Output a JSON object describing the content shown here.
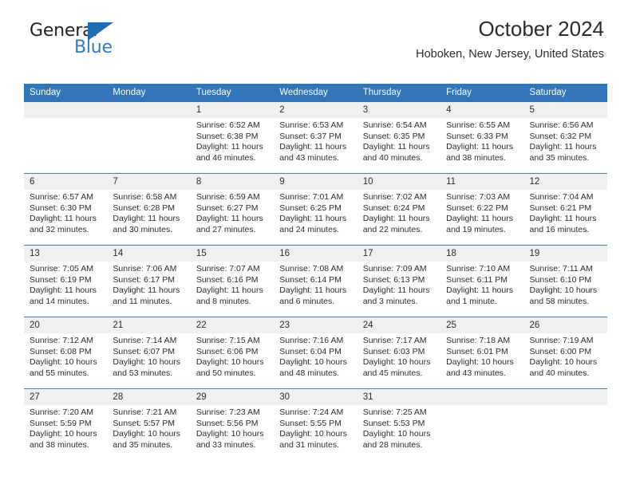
{
  "brand": {
    "name_top": "General",
    "name_bottom": "Blue",
    "logo_icon": "blue-triangle-icon",
    "accent_color": "#2e7cc4"
  },
  "header": {
    "title": "October 2024",
    "subtitle": "Hoboken, New Jersey, United States"
  },
  "theme": {
    "header_blue": "#3275b8",
    "row_band_gray": "#f0f0f0",
    "separator": "#4a7ca8"
  },
  "weekdays": [
    "Sunday",
    "Monday",
    "Tuesday",
    "Wednesday",
    "Thursday",
    "Friday",
    "Saturday"
  ],
  "weeks": [
    {
      "numbers": [
        "",
        "",
        "1",
        "2",
        "3",
        "4",
        "5"
      ],
      "cells": [
        {
          "sunrise": "",
          "sunset": "",
          "daylight": ""
        },
        {
          "sunrise": "",
          "sunset": "",
          "daylight": ""
        },
        {
          "sunrise": "Sunrise: 6:52 AM",
          "sunset": "Sunset: 6:38 PM",
          "daylight": "Daylight: 11 hours and 46 minutes."
        },
        {
          "sunrise": "Sunrise: 6:53 AM",
          "sunset": "Sunset: 6:37 PM",
          "daylight": "Daylight: 11 hours and 43 minutes."
        },
        {
          "sunrise": "Sunrise: 6:54 AM",
          "sunset": "Sunset: 6:35 PM",
          "daylight": "Daylight: 11 hours and 40 minutes."
        },
        {
          "sunrise": "Sunrise: 6:55 AM",
          "sunset": "Sunset: 6:33 PM",
          "daylight": "Daylight: 11 hours and 38 minutes."
        },
        {
          "sunrise": "Sunrise: 6:56 AM",
          "sunset": "Sunset: 6:32 PM",
          "daylight": "Daylight: 11 hours and 35 minutes."
        }
      ]
    },
    {
      "numbers": [
        "6",
        "7",
        "8",
        "9",
        "10",
        "11",
        "12"
      ],
      "cells": [
        {
          "sunrise": "Sunrise: 6:57 AM",
          "sunset": "Sunset: 6:30 PM",
          "daylight": "Daylight: 11 hours and 32 minutes."
        },
        {
          "sunrise": "Sunrise: 6:58 AM",
          "sunset": "Sunset: 6:28 PM",
          "daylight": "Daylight: 11 hours and 30 minutes."
        },
        {
          "sunrise": "Sunrise: 6:59 AM",
          "sunset": "Sunset: 6:27 PM",
          "daylight": "Daylight: 11 hours and 27 minutes."
        },
        {
          "sunrise": "Sunrise: 7:01 AM",
          "sunset": "Sunset: 6:25 PM",
          "daylight": "Daylight: 11 hours and 24 minutes."
        },
        {
          "sunrise": "Sunrise: 7:02 AM",
          "sunset": "Sunset: 6:24 PM",
          "daylight": "Daylight: 11 hours and 22 minutes."
        },
        {
          "sunrise": "Sunrise: 7:03 AM",
          "sunset": "Sunset: 6:22 PM",
          "daylight": "Daylight: 11 hours and 19 minutes."
        },
        {
          "sunrise": "Sunrise: 7:04 AM",
          "sunset": "Sunset: 6:21 PM",
          "daylight": "Daylight: 11 hours and 16 minutes."
        }
      ]
    },
    {
      "numbers": [
        "13",
        "14",
        "15",
        "16",
        "17",
        "18",
        "19"
      ],
      "cells": [
        {
          "sunrise": "Sunrise: 7:05 AM",
          "sunset": "Sunset: 6:19 PM",
          "daylight": "Daylight: 11 hours and 14 minutes."
        },
        {
          "sunrise": "Sunrise: 7:06 AM",
          "sunset": "Sunset: 6:17 PM",
          "daylight": "Daylight: 11 hours and 11 minutes."
        },
        {
          "sunrise": "Sunrise: 7:07 AM",
          "sunset": "Sunset: 6:16 PM",
          "daylight": "Daylight: 11 hours and 8 minutes."
        },
        {
          "sunrise": "Sunrise: 7:08 AM",
          "sunset": "Sunset: 6:14 PM",
          "daylight": "Daylight: 11 hours and 6 minutes."
        },
        {
          "sunrise": "Sunrise: 7:09 AM",
          "sunset": "Sunset: 6:13 PM",
          "daylight": "Daylight: 11 hours and 3 minutes."
        },
        {
          "sunrise": "Sunrise: 7:10 AM",
          "sunset": "Sunset: 6:11 PM",
          "daylight": "Daylight: 11 hours and 1 minute."
        },
        {
          "sunrise": "Sunrise: 7:11 AM",
          "sunset": "Sunset: 6:10 PM",
          "daylight": "Daylight: 10 hours and 58 minutes."
        }
      ]
    },
    {
      "numbers": [
        "20",
        "21",
        "22",
        "23",
        "24",
        "25",
        "26"
      ],
      "cells": [
        {
          "sunrise": "Sunrise: 7:12 AM",
          "sunset": "Sunset: 6:08 PM",
          "daylight": "Daylight: 10 hours and 55 minutes."
        },
        {
          "sunrise": "Sunrise: 7:14 AM",
          "sunset": "Sunset: 6:07 PM",
          "daylight": "Daylight: 10 hours and 53 minutes."
        },
        {
          "sunrise": "Sunrise: 7:15 AM",
          "sunset": "Sunset: 6:06 PM",
          "daylight": "Daylight: 10 hours and 50 minutes."
        },
        {
          "sunrise": "Sunrise: 7:16 AM",
          "sunset": "Sunset: 6:04 PM",
          "daylight": "Daylight: 10 hours and 48 minutes."
        },
        {
          "sunrise": "Sunrise: 7:17 AM",
          "sunset": "Sunset: 6:03 PM",
          "daylight": "Daylight: 10 hours and 45 minutes."
        },
        {
          "sunrise": "Sunrise: 7:18 AM",
          "sunset": "Sunset: 6:01 PM",
          "daylight": "Daylight: 10 hours and 43 minutes."
        },
        {
          "sunrise": "Sunrise: 7:19 AM",
          "sunset": "Sunset: 6:00 PM",
          "daylight": "Daylight: 10 hours and 40 minutes."
        }
      ]
    },
    {
      "numbers": [
        "27",
        "28",
        "29",
        "30",
        "31",
        "",
        ""
      ],
      "cells": [
        {
          "sunrise": "Sunrise: 7:20 AM",
          "sunset": "Sunset: 5:59 PM",
          "daylight": "Daylight: 10 hours and 38 minutes."
        },
        {
          "sunrise": "Sunrise: 7:21 AM",
          "sunset": "Sunset: 5:57 PM",
          "daylight": "Daylight: 10 hours and 35 minutes."
        },
        {
          "sunrise": "Sunrise: 7:23 AM",
          "sunset": "Sunset: 5:56 PM",
          "daylight": "Daylight: 10 hours and 33 minutes."
        },
        {
          "sunrise": "Sunrise: 7:24 AM",
          "sunset": "Sunset: 5:55 PM",
          "daylight": "Daylight: 10 hours and 31 minutes."
        },
        {
          "sunrise": "Sunrise: 7:25 AM",
          "sunset": "Sunset: 5:53 PM",
          "daylight": "Daylight: 10 hours and 28 minutes."
        },
        {
          "sunrise": "",
          "sunset": "",
          "daylight": ""
        },
        {
          "sunrise": "",
          "sunset": "",
          "daylight": ""
        }
      ]
    }
  ]
}
